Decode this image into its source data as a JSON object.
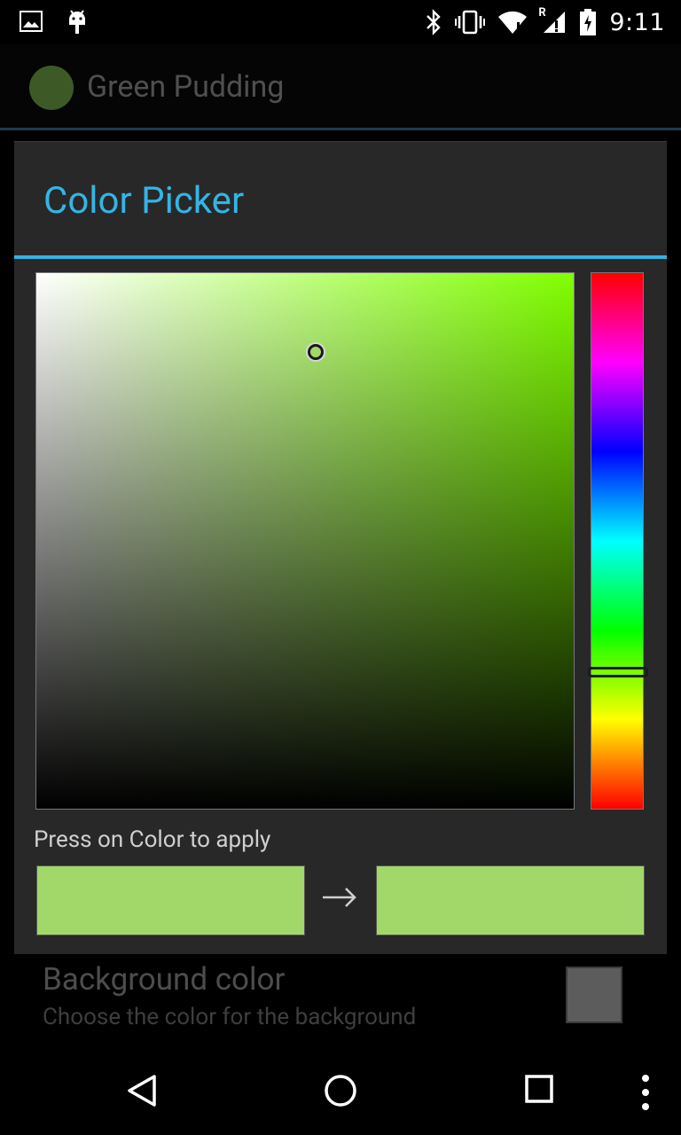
{
  "status_bar": {
    "time": "9:11",
    "roaming_indicator": "R",
    "icons_left": [
      "gallery-icon",
      "android-debug-icon"
    ],
    "icons_right": [
      "bluetooth-icon",
      "vibrate-icon",
      "wifi-icon",
      "signal-icon",
      "battery-icon"
    ]
  },
  "app_bar": {
    "title": "Green Pudding",
    "logo_color": "#3d5a26"
  },
  "dialog": {
    "title": "Color Picker",
    "accent_color": "#33b5e5",
    "hue_color": "#80ff00",
    "hint": "Press on Color to apply",
    "old_color": "#a2d86a",
    "new_color": "#a2d86a",
    "arrow": "→"
  },
  "preference": {
    "title": "Background color",
    "summary": "Choose the color for the background",
    "swatch_color": "#5c5c5c"
  },
  "nav_bar": {
    "buttons": [
      "back-button",
      "home-button",
      "recents-button",
      "overflow-menu-button"
    ]
  }
}
